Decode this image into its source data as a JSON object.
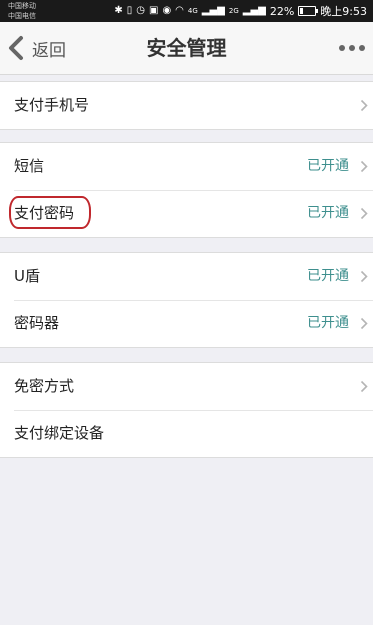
{
  "status_bar": {
    "carrier_1": "中国移动",
    "carrier_2": "中国电信",
    "network_1": "4G",
    "network_2": "2G",
    "battery": "22%",
    "battery_level": 0.22,
    "time": "晚上9:53"
  },
  "nav": {
    "back_label": "返回",
    "title": "安全管理"
  },
  "groups": [
    {
      "rows": [
        {
          "label": "支付手机号",
          "status": ""
        }
      ]
    },
    {
      "rows": [
        {
          "label": "短信",
          "status": "已开通"
        },
        {
          "label": "支付密码",
          "status": "已开通"
        }
      ]
    },
    {
      "rows": [
        {
          "label": "U盾",
          "status": "已开通"
        },
        {
          "label": "密码器",
          "status": "已开通"
        }
      ]
    },
    {
      "rows": [
        {
          "label": "免密方式",
          "status": ""
        },
        {
          "label": "支付绑定设备",
          "status": ""
        }
      ]
    }
  ],
  "colors": {
    "status_text": "#3e8f8e",
    "highlight_ring": "#c0282d",
    "background": "#efeff4"
  },
  "icons": {
    "back": "chevron-left-icon",
    "more": "more-dots-icon",
    "row_arrow": "chevron-right-icon"
  }
}
